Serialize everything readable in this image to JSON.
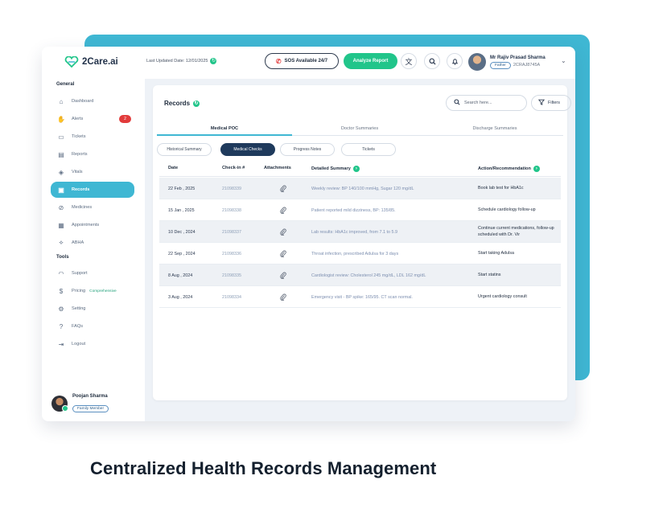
{
  "brand": {
    "name": "2Care.ai"
  },
  "header": {
    "last_updated": "Last Updated Date: 12/01/2025",
    "sos_label": "SOS Available 24/7",
    "analyze_label": "Analyze Report",
    "user_name": "Mr Rajiv Prasad Sharma",
    "user_relation": "Father",
    "user_id": "2CRAJ8745A"
  },
  "sidebar": {
    "general_title": "General",
    "tools_title": "Tools",
    "items": [
      {
        "label": "Dashboard",
        "icon": "home-icon",
        "glyph": "⌂"
      },
      {
        "label": "Alerts",
        "icon": "hand-icon",
        "glyph": "✋",
        "badge": "2"
      },
      {
        "label": "Tickets",
        "icon": "ticket-icon",
        "glyph": "▭"
      },
      {
        "label": "Reports",
        "icon": "report-icon",
        "glyph": "▤"
      },
      {
        "label": "Vitals",
        "icon": "vitals-icon",
        "glyph": "◈"
      },
      {
        "label": "Records",
        "icon": "records-icon",
        "glyph": "▣",
        "active": true
      },
      {
        "label": "Medicines",
        "icon": "pill-icon",
        "glyph": "⊘"
      },
      {
        "label": "Appointments",
        "icon": "calendar-icon",
        "glyph": "▦"
      },
      {
        "label": "ABHA",
        "icon": "abha-icon",
        "glyph": "⟡"
      }
    ],
    "tools": [
      {
        "label": "Support",
        "icon": "headset-icon",
        "glyph": "◠"
      },
      {
        "label": "Pricing",
        "icon": "dollar-icon",
        "glyph": "$",
        "sub": "Comprehensive"
      },
      {
        "label": "Setting",
        "icon": "gear-icon",
        "glyph": "⚙"
      },
      {
        "label": "FAQs",
        "icon": "question-icon",
        "glyph": "?"
      },
      {
        "label": "Logout",
        "icon": "logout-icon",
        "glyph": "⇥"
      }
    ],
    "user": {
      "name": "Poojan Sharma",
      "role": "Family Member"
    }
  },
  "records": {
    "title": "Records",
    "search_placeholder": "Search here...",
    "filters_label": "Filters",
    "tabs": [
      "Medical POC",
      "Doctor Summaries",
      "Discharge Summaries"
    ],
    "chips": [
      "Historical Summary",
      "Medical Checks",
      "Progress Notes",
      "Tickets"
    ],
    "active_chip": "Medical Checks",
    "columns": [
      "Date",
      "Check-in #",
      "Attachments",
      "Detailed Summary",
      "Action/Recommendation"
    ],
    "rows": [
      {
        "date": "22 Feb , 2025",
        "checkin": "21098339",
        "summary": "Weekly review: BP 140/100 mmHg, Sugar 120 mg/dL",
        "action": "Book lab test for HbA1c"
      },
      {
        "date": "15 Jan , 2025",
        "checkin": "21098338",
        "summary": "Patient reported mild dizziness, BP: 135/85.",
        "action": "Schedule cardiology follow-up"
      },
      {
        "date": "10 Dec , 2024",
        "checkin": "21098337",
        "summary": "Lab results: HbA1c improved, from 7.1 to 5.9",
        "action": "Continue current medications, follow-up scheduled with Dr. Vir"
      },
      {
        "date": "22 Sep , 2024",
        "checkin": "21098336",
        "summary": "Throat infection, prescribed Adulsa for 3 days",
        "action": "Start taking Adulsa"
      },
      {
        "date": "8 Aug , 2024",
        "checkin": "21098335",
        "summary": "Cardiologist review: Cholesterol 245 mg/dL, LDL 162 mg/dL",
        "action": "Start statins"
      },
      {
        "date": "3 Aug , 2024",
        "checkin": "21098334",
        "summary": "Emergency visit - BP spike: 165/95. CT scan normal.",
        "action": "Urgent cardiology consult"
      }
    ]
  },
  "caption": "Centralized Health Records Management",
  "colors": {
    "accent": "#3fb7d3",
    "green": "#21c58a",
    "navy": "#1f3a5c",
    "alert": "#e23b3b"
  }
}
